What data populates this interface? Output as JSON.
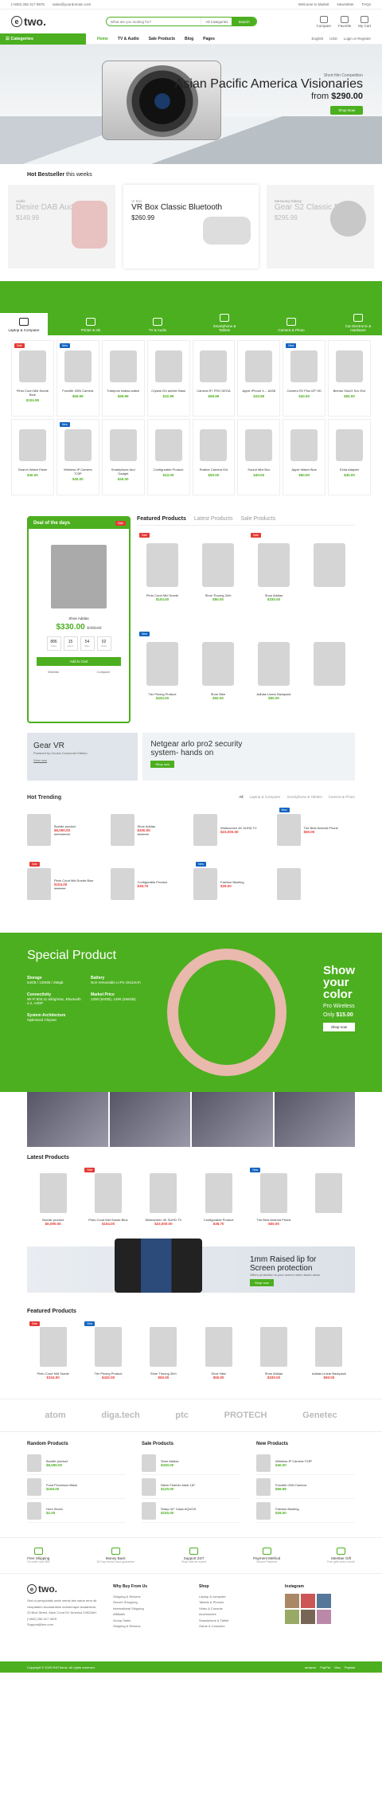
{
  "topbar": {
    "phone": "(+800) 256 317 9876",
    "email": "sales@yourdomain.com",
    "welcome": "Welcome to Market",
    "newsletter": "Newsletter",
    "faq": "FAQs"
  },
  "header": {
    "search_placeholder": "What are you looking for?",
    "categories_label": "All Categories",
    "search_btn": "Search",
    "compare": "Compare",
    "favorite": "Favorite",
    "cart": "My Cart"
  },
  "nav": {
    "categories": "Categories",
    "items": [
      "Home",
      "TV & Audio",
      "Sale Products",
      "Blog",
      "Pages"
    ],
    "lang": "English",
    "currency": "USD",
    "login": "Login or Register"
  },
  "hero": {
    "sub": "Short film Competition",
    "title": "Asian Pacific America Visionaries",
    "price_prefix": "from",
    "price": "$290.00",
    "btn": "Shop Now"
  },
  "bestseller": {
    "title": "Hot Bestseller",
    "title2": "this weeks",
    "items": [
      {
        "k": "Audio",
        "n": "Desire DAB Audios",
        "p": "$149.99"
      },
      {
        "k": "Vr Box",
        "n": "VR Box Classic Bluetooth",
        "p": "$260.99"
      },
      {
        "k": "Samsung Galaxy",
        "n": "Gear S2 Classic Black",
        "p": "$295.99"
      }
    ]
  },
  "categories": [
    "Laptop & Computer",
    "Printer & Ink",
    "TV & Audio",
    "Smartphone & Tablets",
    "Camera & Photo",
    "Car Electronic & Hardware"
  ],
  "grid": [
    {
      "n": "Pinto Court Mid Suede Blue",
      "p": "$104.99",
      "b": "Sale"
    },
    {
      "n": "Fonofile I20N Camera",
      "p": "$59.99",
      "b": "New"
    },
    {
      "n": "Tubepoto Iwatsa watch",
      "p": "$69.99",
      "b": ""
    },
    {
      "n": "Crystal Clh ambler Bass",
      "p": "$32.99",
      "b": ""
    },
    {
      "n": "Camera R7 FRO DEGA",
      "p": "$59.99",
      "b": ""
    },
    {
      "n": "Apple iPhone 4 – 16GB",
      "p": "$33.99",
      "b": ""
    },
    {
      "n": "Camera R2 Plus IZF HD",
      "p": "$40.00",
      "b": "New"
    },
    {
      "n": "Beeoto SoloG Sov Eve",
      "p": "$50.00",
      "b": ""
    },
    {
      "n": "Gearvn Watch Eiwer",
      "p": "$40.00",
      "b": ""
    },
    {
      "n": "Wireless IP Camera T23P",
      "p": "$40.00",
      "b": "New"
    },
    {
      "n": "Smartphone And Gadget",
      "p": "$40.00",
      "b": ""
    },
    {
      "n": "Configurable Product",
      "p": "$43.00",
      "b": ""
    },
    {
      "n": "Rubber Camera Ext",
      "p": "$50.00",
      "b": ""
    },
    {
      "n": "Sound Mini Box",
      "p": "$40.00",
      "b": ""
    },
    {
      "n": "Apple Watch Blue",
      "p": "$60.00",
      "b": ""
    },
    {
      "n": "Extra Adapter",
      "p": "$40.00",
      "b": ""
    }
  ],
  "deal": {
    "title": "Deal of the days",
    "badge": "Sale",
    "name": "Shoe Adidas",
    "price": "$330.00",
    "old": "$400.00",
    "timer": [
      {
        "v": "886",
        "l": "Days"
      },
      {
        "v": "15",
        "l": "Hours"
      },
      {
        "v": "54",
        "l": "Mins"
      },
      {
        "v": "02",
        "l": "Secs"
      }
    ],
    "btn": "Add to Cart",
    "wish": "Wishlist",
    "compare": "Compare"
  },
  "featured": {
    "tabs": [
      "Featured Products",
      "Latest Products",
      "Sale Products"
    ],
    "items": [
      {
        "n": "Pinto Court Mid Suede",
        "p": "$104.00",
        "b": "Sale"
      },
      {
        "n": "Shoe Thuong Zinh",
        "p": "$50.00",
        "b": ""
      },
      {
        "n": "Shoe Adidas",
        "p": "$330.00",
        "b": "Sale"
      },
      {
        "n": "",
        "p": "",
        "b": ""
      },
      {
        "n": "Tier Pricing Product",
        "p": "$432.00",
        "b": "New"
      },
      {
        "n": "Shoe Nike",
        "p": "$50.00",
        "b": ""
      },
      {
        "n": "Adidas Linear Backpack",
        "p": "$50.00",
        "b": ""
      },
      {
        "n": "",
        "p": "",
        "b": ""
      }
    ]
  },
  "promo": {
    "p1_title": "Gear VR",
    "p1_sub": "Powered by Oculus Consumer Edition",
    "p1_link": "View now",
    "p2_title": "Netgear arlo pro2 security system- hands on",
    "p2_btn": "Shop now"
  },
  "trending": {
    "title": "Hot Trending",
    "tabs": [
      "All",
      "Laptop & Computer",
      "Smartphone & Tablets",
      "Camera & Photo"
    ],
    "items": [
      {
        "n": "Bundle product",
        "p": "$6,090.00",
        "o": "$47,188.00",
        "b": ""
      },
      {
        "n": "Shoe Adidas",
        "p": "$330.00",
        "o": "$400.00",
        "b": ""
      },
      {
        "n": "Widescreen 4K SUHD TV",
        "p": "$23,000.00",
        "o": "",
        "b": ""
      },
      {
        "n": "The Best Android Phone",
        "p": "$50.00",
        "o": "",
        "b": "New"
      },
      {
        "n": "Pinto Court Mid Suede Blue",
        "p": "$104.00",
        "o": "$120.00",
        "b": "Sale"
      },
      {
        "n": "Configurable Product",
        "p": "$38.70",
        "o": "",
        "b": ""
      },
      {
        "n": "Fashion Blueling",
        "p": "$29.00",
        "o": "",
        "b": "New"
      },
      {
        "n": "",
        "p": "",
        "o": "",
        "b": ""
      }
    ]
  },
  "special": {
    "title": "Special Product",
    "specs": [
      {
        "t": "Storage",
        "d": "64GB / 128GB / 256gb"
      },
      {
        "t": "Battery",
        "d": "Non-removable Li-Po 1911mAh"
      },
      {
        "t": "Connectivity",
        "d": "Wi-Fi 802.11 a/b/g/n/ac, Bluetooth 4.2, A2DP"
      },
      {
        "t": "Market Price",
        "d": "1200 (64GB), 1490 (256GB)"
      },
      {
        "t": "System Architecture",
        "d": "Optimized Chipset"
      }
    ],
    "show1": "Show",
    "show2": "your",
    "show3": "color",
    "sub": "Pro Wireless",
    "from": "Only",
    "price": "$15.00",
    "btn": "Shop now"
  },
  "latest": {
    "title": "Latest Products",
    "items": [
      {
        "n": "Bundle product",
        "p": "$6,090.00",
        "o": "$47,188.00",
        "b": ""
      },
      {
        "n": "Pinto Court Mid Suede Blue",
        "p": "$104.00",
        "o": "$120.00",
        "b": "Sale"
      },
      {
        "n": "Widescreen 4K SUHD TV",
        "p": "$23,000.00",
        "o": "",
        "b": ""
      },
      {
        "n": "Configurable Product",
        "p": "$38.70",
        "o": "",
        "b": ""
      },
      {
        "n": "The Best Android Phone",
        "p": "$50.00",
        "o": "",
        "b": "New"
      },
      {
        "n": "",
        "p": "",
        "o": "",
        "b": ""
      }
    ]
  },
  "banner2": {
    "title": "1mm Raised lip for Screen protection",
    "sub": "Offers protection to your screen when faced down",
    "btn": "Shop now"
  },
  "featured2": {
    "title": "Featured Products",
    "items": [
      {
        "n": "Pinto Court Mid Suede",
        "p": "$104.00",
        "b": "Sale"
      },
      {
        "n": "Tier Pricing Product",
        "p": "$432.00",
        "b": "New"
      },
      {
        "n": "Shoe Thuong Zinh",
        "p": "$50.00",
        "b": ""
      },
      {
        "n": "Shoe Nike",
        "p": "$50.00",
        "b": ""
      },
      {
        "n": "Shoe Adidas",
        "p": "$330.00",
        "b": ""
      },
      {
        "n": "Adidas Linear Backpack",
        "p": "$50.00",
        "b": ""
      }
    ]
  },
  "brands": [
    "atom",
    "diga.tech",
    "ptc",
    "PROTECH",
    "Genetec"
  ],
  "lists": [
    {
      "title": "Random Products",
      "items": [
        {
          "n": "Bundle product",
          "p": "$6,090.00"
        },
        {
          "n": "Food Processor Black",
          "p": "$150.00"
        },
        {
          "n": "Hors Seven",
          "p": "$2.00"
        }
      ]
    },
    {
      "title": "Sale Products",
      "items": [
        {
          "n": "Shoe Adidas",
          "p": "$330.00"
        },
        {
          "n": "Nikon Federer Adult 187",
          "p": "$120.00"
        },
        {
          "n": "Sharp 32\" Class AQUOS",
          "p": "$100.00"
        }
      ]
    },
    {
      "title": "New Products",
      "items": [
        {
          "n": "Wireless IP Camera T23P",
          "p": "$40.00"
        },
        {
          "n": "Fonofile I20N Camera",
          "p": "$59.99"
        },
        {
          "n": "Fashion Blueling",
          "p": "$29.00"
        }
      ]
    }
  ],
  "features": [
    {
      "t": "Free Shipping",
      "s": "On order over $99"
    },
    {
      "t": "Money Back",
      "s": "30 Day money back guarantee"
    },
    {
      "t": "Support 24/7",
      "s": "Shop with an expert"
    },
    {
      "t": "Payment Method",
      "s": "Secure Payment"
    },
    {
      "t": "Member Gift",
      "s": "Free gifts every month"
    }
  ],
  "footer": {
    "about": "Sed ut perspiciatis unde omnis iste natus error sit voluptatem accusantium doloremque laudantium.",
    "address": "23 Blvd Street, Alton Court NY America 10923AH",
    "phone": "(+800) 256 317 9876",
    "email": "Support@lmx.com",
    "col2t": "Why Buy From Us",
    "col2": [
      "Shipping & Returns",
      "Secure Shopping",
      "International Shipping",
      "Affiliates",
      "Group Sales",
      "Shipping & Returns"
    ],
    "col3t": "Shop",
    "col3": [
      "Laptop & computer",
      "Tablets & Phones",
      "Video & Console",
      "Accessories",
      "Smartphone & Tablet",
      "Game & Consoles"
    ],
    "col4t": "Instagram"
  },
  "copyright": "Copyright © 2020 RoiTheme. All rights reserved.",
  "pay": [
    "amazon",
    "PayPal",
    "Visa",
    "Payfast"
  ]
}
